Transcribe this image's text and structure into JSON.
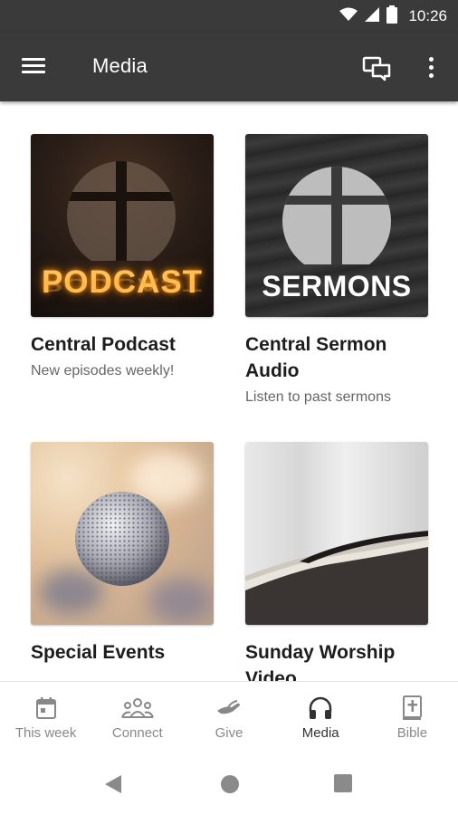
{
  "status_bar": {
    "time": "10:26"
  },
  "app_bar": {
    "title": "Media"
  },
  "cards": [
    {
      "title": "Central Podcast",
      "subtitle": "New episodes weekly!",
      "thumb_text": "PODCAST"
    },
    {
      "title": "Central Sermon Audio",
      "subtitle": "Listen to past sermons",
      "thumb_text": "SERMONS"
    },
    {
      "title": "Special Events",
      "subtitle": ""
    },
    {
      "title": "Sunday Worship Video",
      "subtitle": ""
    }
  ],
  "bottom_nav": [
    {
      "label": "This week",
      "icon": "calendar-icon"
    },
    {
      "label": "Connect",
      "icon": "people-icon"
    },
    {
      "label": "Give",
      "icon": "give-icon"
    },
    {
      "label": "Media",
      "icon": "headphones-icon",
      "active": true
    },
    {
      "label": "Bible",
      "icon": "bible-icon"
    }
  ]
}
